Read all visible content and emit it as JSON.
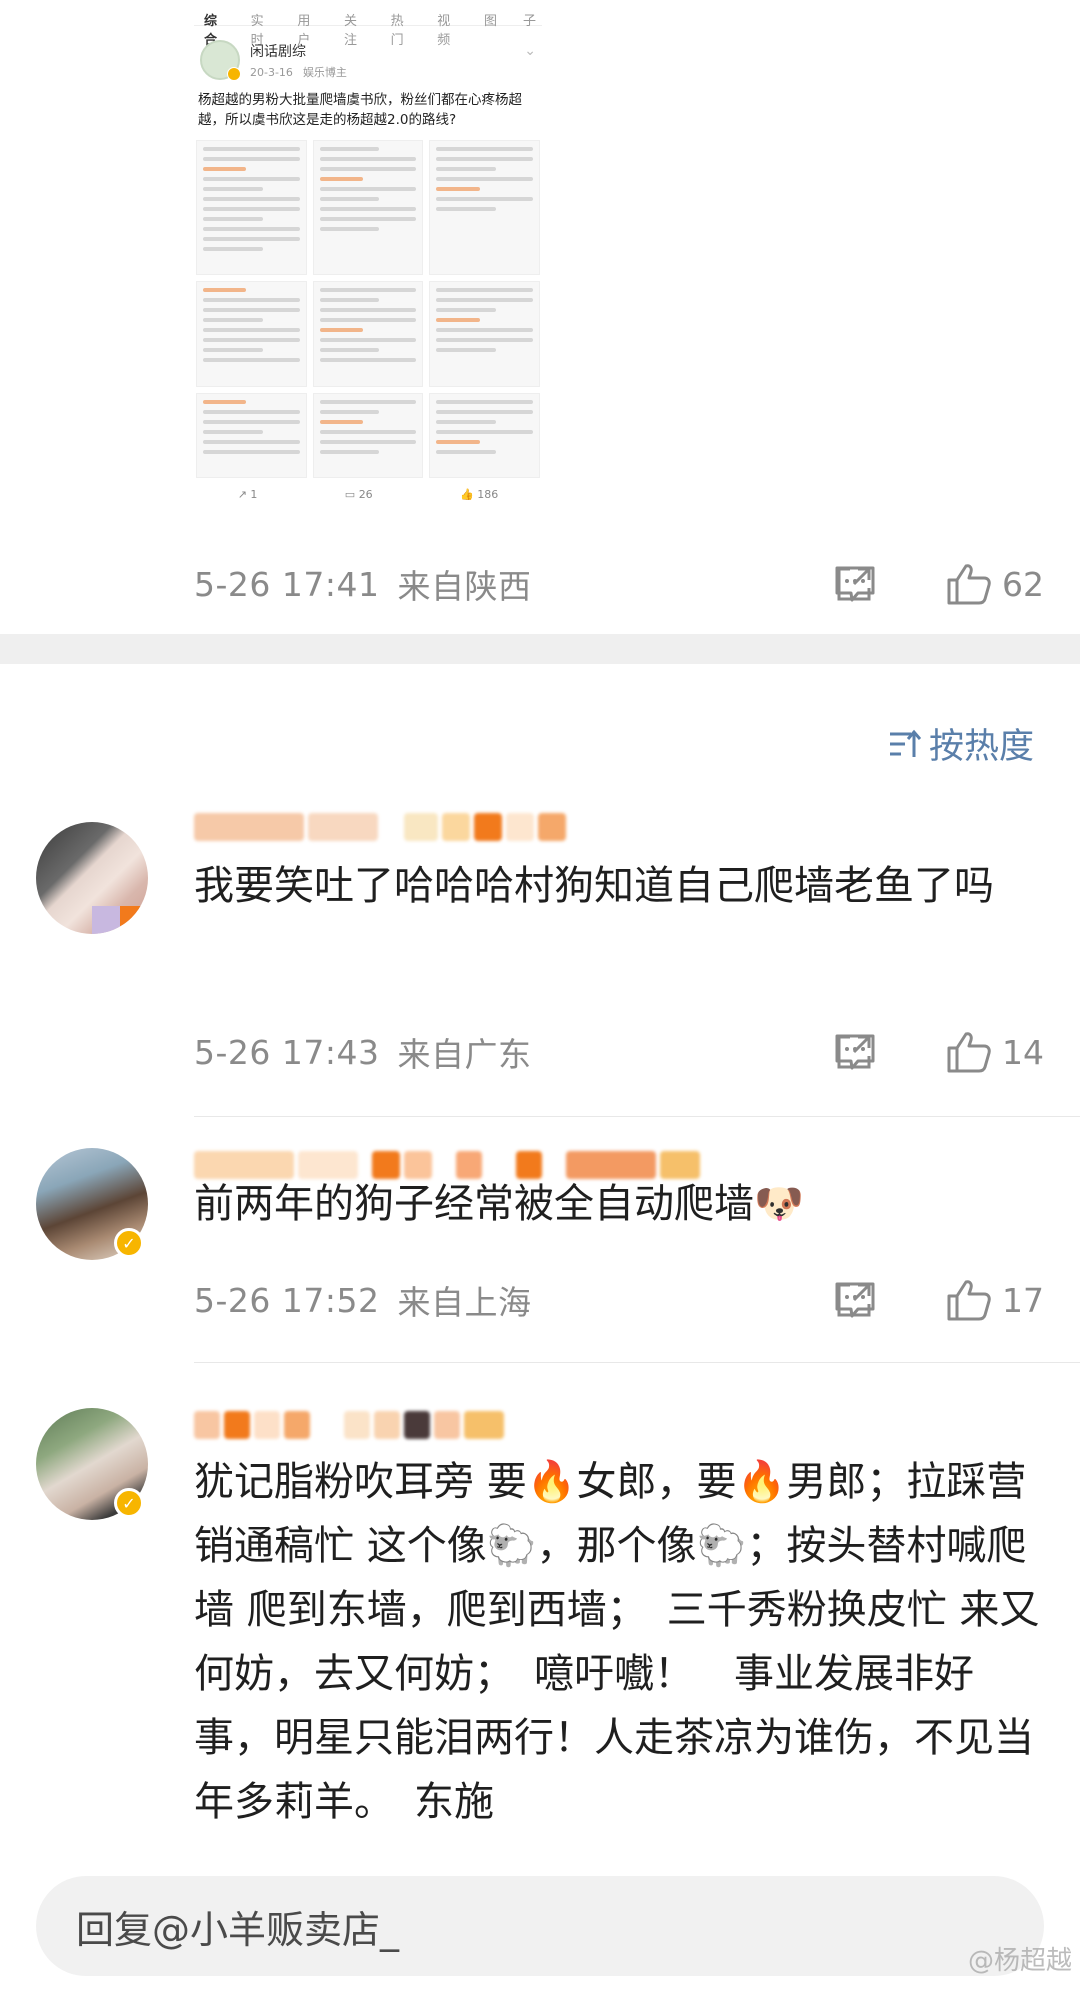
{
  "embed": {
    "tabs": [
      "综合",
      "实时",
      "用户",
      "关注",
      "热门",
      "视频",
      "图",
      "子"
    ],
    "author": "闲话剧综",
    "date": "20-3-16",
    "source": "娱乐博主",
    "text": "杨超越的男粉大批量爬墙虞书欣，粉丝们都在心疼杨超越，所以虞书欣这是走的杨超越2.0的路线?",
    "actions": {
      "share": "1",
      "comments": "26",
      "likes": "186"
    }
  },
  "post": {
    "time": "5-26 17:41",
    "location": "来自陕西",
    "likes": "62"
  },
  "sort": {
    "label": "按热度"
  },
  "comments": [
    {
      "text": "我要笑吐了哈哈哈村狗知道自己爬墙老鱼了吗",
      "time": "5-26 17:43",
      "location": "来自广东",
      "likes": "14"
    },
    {
      "text": "前两年的狗子经常被全自动爬墙🐶",
      "time": "5-26 17:52",
      "location": "来自上海",
      "likes": "17"
    },
    {
      "text": "犹记脂粉吹耳旁 要🔥女郎，要🔥男郎；拉踩营销通稿忙 这个像🐑，那个像🐑；按头替村喊爬墙 爬到东墙，爬到西墙；　三千秀粉换皮忙 来又何妨，去又何妨；　噫吁嚱！　事业发展非好事，明星只能泪两行！人走茶凉为谁伤，不见当年多莉羊。　东施"
    }
  ],
  "reply": {
    "placeholder": "回复@小羊贩卖店_"
  },
  "watermark": "@杨超越"
}
